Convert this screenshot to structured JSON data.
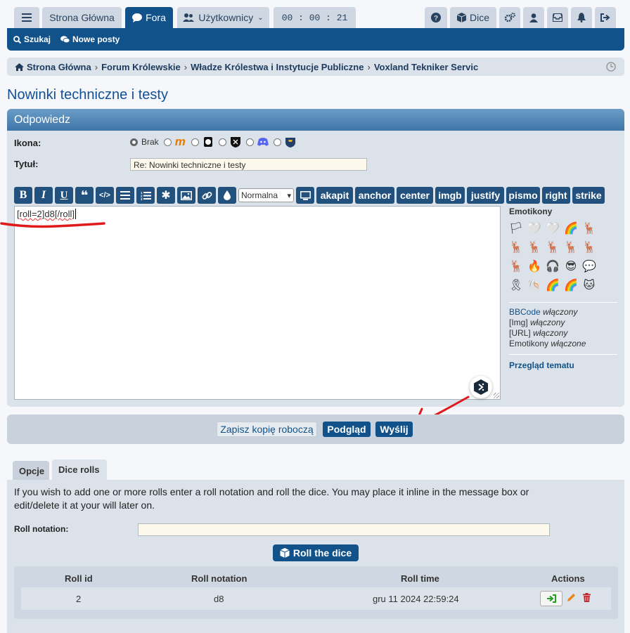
{
  "topbar": {
    "home_label": "Strona Główna",
    "forums_label": "Fora",
    "users_label": "Użytkownicy",
    "timer": "00 : 00 : 21",
    "dice_label": "Dice"
  },
  "navbar": {
    "search_label": "Szukaj",
    "new_posts_label": "Nowe posty"
  },
  "breadcrumbs": [
    "Strona Główna",
    "Forum Królewskie",
    "Władze Królestwa i Instytucje Publiczne",
    "Voxland Tekniker Servic"
  ],
  "topic_title": "Nowinki techniczne i testy",
  "reply": {
    "heading": "Odpowiedz",
    "icon_label": "Ikona:",
    "icon_none": "Brak",
    "title_label": "Tytuł:",
    "title_value": "Re: Nowinki techniczne i testy",
    "font_size_selected": "Normalna",
    "custom_bbcodes": [
      "akapit",
      "anchor",
      "center",
      "imgb",
      "justify",
      "pismo",
      "right",
      "strike"
    ],
    "message": "[roll=2]d8[/roll]"
  },
  "sidebar": {
    "emoticons_heading": "Emotikony",
    "emoticons": [
      "🏳",
      "🤍",
      "🤍",
      "🌈",
      "🦌",
      "🦌",
      "🦌",
      "🦌",
      "🦌",
      "🦌",
      "🦌",
      "🔥",
      "🎧",
      "😎",
      "💬",
      "🎗",
      "🐚",
      "🌈",
      "🌈",
      "🐱"
    ],
    "bbcode_link": "BBCode",
    "bbcode_state": "włączony",
    "img_label": "[Img]",
    "img_state": "włączony",
    "url_label": "[URL]",
    "url_state": "włączony",
    "smilies_label": "Emotikony",
    "smilies_state": "włączone",
    "topic_review": "Przegląd tematu"
  },
  "submit": {
    "save_draft": "Zapisz kopię roboczą",
    "preview": "Podgląd",
    "send": "Wyślij"
  },
  "tabs": [
    "Opcje",
    "Dice rolls"
  ],
  "dice": {
    "intro": "If you wish to add one or more rolls enter a roll notation and roll the dice. You may place it inline in the message box or edit/delete it at your will later on.",
    "notation_label": "Roll notation:",
    "notation_value": "",
    "roll_button": "Roll the dice",
    "columns": [
      "Roll id",
      "Roll notation",
      "Roll time",
      "Actions"
    ],
    "rows": [
      {
        "id": "2",
        "notation": "d8",
        "time": "gru 11 2024 22:59:24"
      }
    ]
  },
  "colors": {
    "primary": "#105289",
    "annotation": "#e0191b"
  }
}
